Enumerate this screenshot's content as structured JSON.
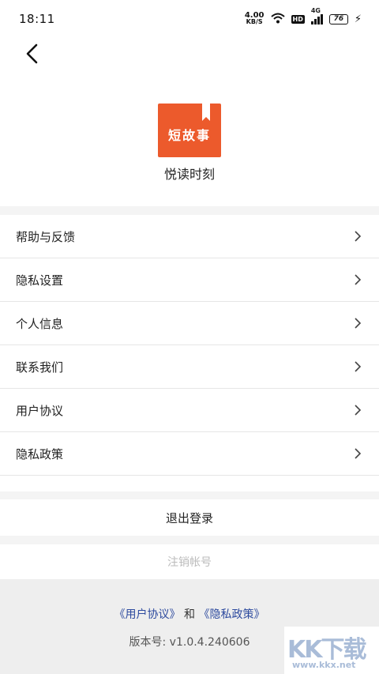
{
  "status_bar": {
    "time": "18:11",
    "net_speed_value": "4.00",
    "net_speed_unit": "KB/S",
    "hd_label": "HD",
    "network_label": "4G",
    "battery_level": "76"
  },
  "app": {
    "logo_text": "短故事",
    "name": "悦读时刻"
  },
  "menu": {
    "items": [
      {
        "label": "帮助与反馈"
      },
      {
        "label": "隐私设置"
      },
      {
        "label": "个人信息"
      },
      {
        "label": "联系我们"
      },
      {
        "label": "用户协议"
      },
      {
        "label": "隐私政策"
      }
    ]
  },
  "actions": {
    "logout_label": "退出登录",
    "cancel_account_label": "注销帐号"
  },
  "footer": {
    "user_agreement_link": "《用户协议》",
    "and_text": "和",
    "privacy_policy_link": "《隐私政策》",
    "version_text": "版本号: v1.0.4.240606"
  },
  "watermark": {
    "text": "KK下载",
    "url": "www.kkx.net"
  },
  "colors": {
    "logo_bg": "#ec5a2c",
    "link": "#2d4a9e",
    "disabled_text": "#bbbbbb",
    "divider_band": "#f4f4f4"
  }
}
